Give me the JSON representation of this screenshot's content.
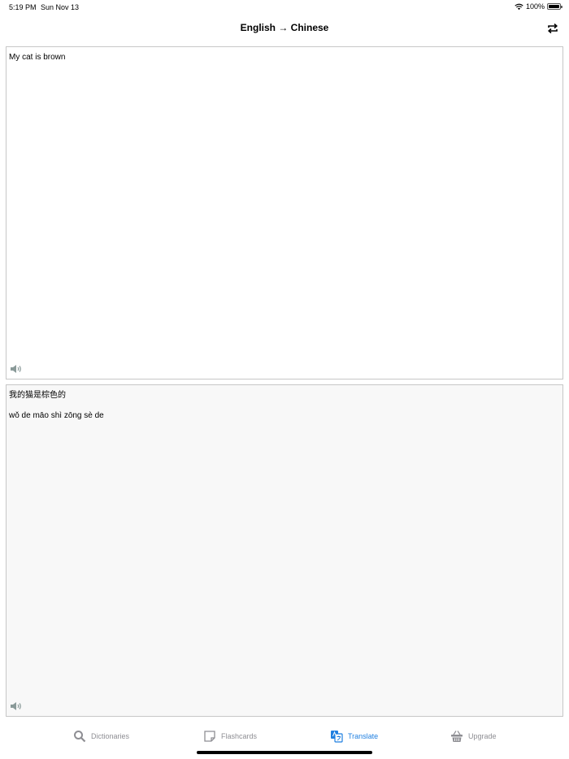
{
  "status_bar": {
    "time": "5:19 PM",
    "date": "Sun Nov 13",
    "battery_text": "100%",
    "battery_level": 1.0
  },
  "nav": {
    "title": "English → Chinese",
    "swap_icon": "swap-arrows-icon"
  },
  "input_pane": {
    "text": "My cat is brown",
    "speaker_icon": "speaker-icon"
  },
  "output_pane": {
    "text": "我的猫是棕色的",
    "pinyin": "wǒ de māo shì zōng sè de",
    "speaker_icon": "speaker-icon"
  },
  "tabs": [
    {
      "label": "Dictionaries",
      "icon": "search-icon",
      "active": false
    },
    {
      "label": "Flashcards",
      "icon": "note-icon",
      "active": false
    },
    {
      "label": "Translate",
      "icon": "translate-icon",
      "active": true
    },
    {
      "label": "Upgrade",
      "icon": "basket-icon",
      "active": false
    }
  ],
  "colors": {
    "accent": "#1f7fe0",
    "tab_inactive": "#8e8e93",
    "pane_border": "#c7c7c7",
    "output_background": "#f8f8f8"
  }
}
